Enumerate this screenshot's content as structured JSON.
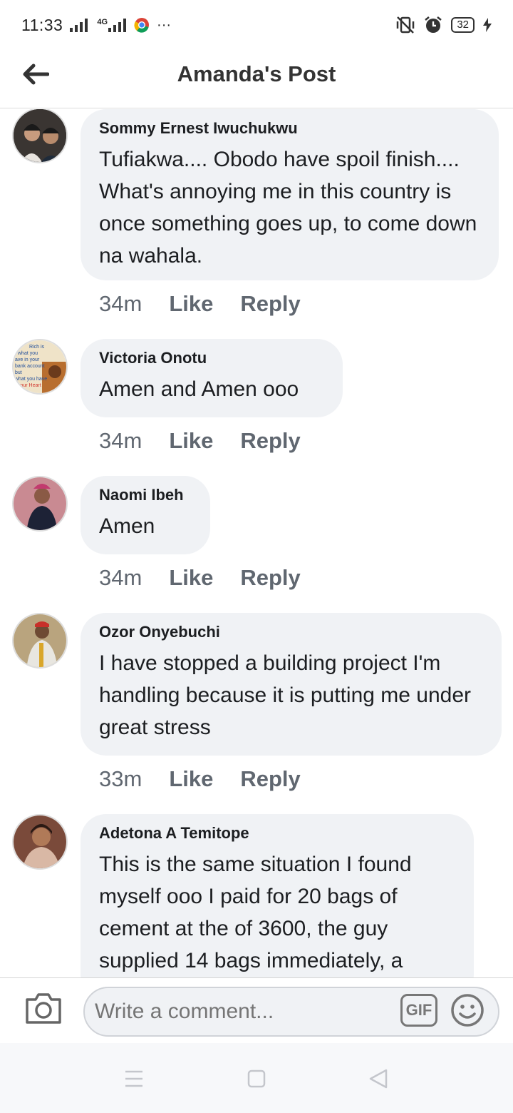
{
  "status_bar": {
    "time": "11:33",
    "network": "4G",
    "battery": "32",
    "more": "···"
  },
  "header": {
    "title": "Amanda's Post"
  },
  "comments": [
    {
      "author": "Sommy Ernest Iwuchukwu",
      "text": "Tufiakwa.... Obodo have spoil finish.... What's annoying me in this country is once something goes up, to come down na wahala.",
      "time": "34m",
      "like": "Like",
      "reply": "Reply"
    },
    {
      "author": "Victoria Onotu",
      "text": "Amen and Amen ooo",
      "time": "34m",
      "like": "Like",
      "reply": "Reply",
      "avatar_text": [
        "Rich is",
        "what you",
        "ave in your",
        "bank account",
        "but",
        "what you have",
        "your Heart"
      ]
    },
    {
      "author": "Naomi Ibeh",
      "text": "Amen",
      "time": "34m",
      "like": "Like",
      "reply": "Reply"
    },
    {
      "author": "Ozor Onyebuchi",
      "text": "I have stopped a building project I'm handling because it is putting me under great stress",
      "time": "33m",
      "like": "Like",
      "reply": "Reply"
    },
    {
      "author": "Adetona A Temitope",
      "text": "This is the same situation I found myself ooo I paid for 20 bags of cement at the of 3600, the guy supplied 14 bags immediately, a"
    }
  ],
  "composer": {
    "placeholder": "Write a comment...",
    "gif_label": "GIF"
  },
  "colors": {
    "bubble": "#f0f2f5",
    "meta_text": "#606770",
    "background": "#ffffff"
  }
}
